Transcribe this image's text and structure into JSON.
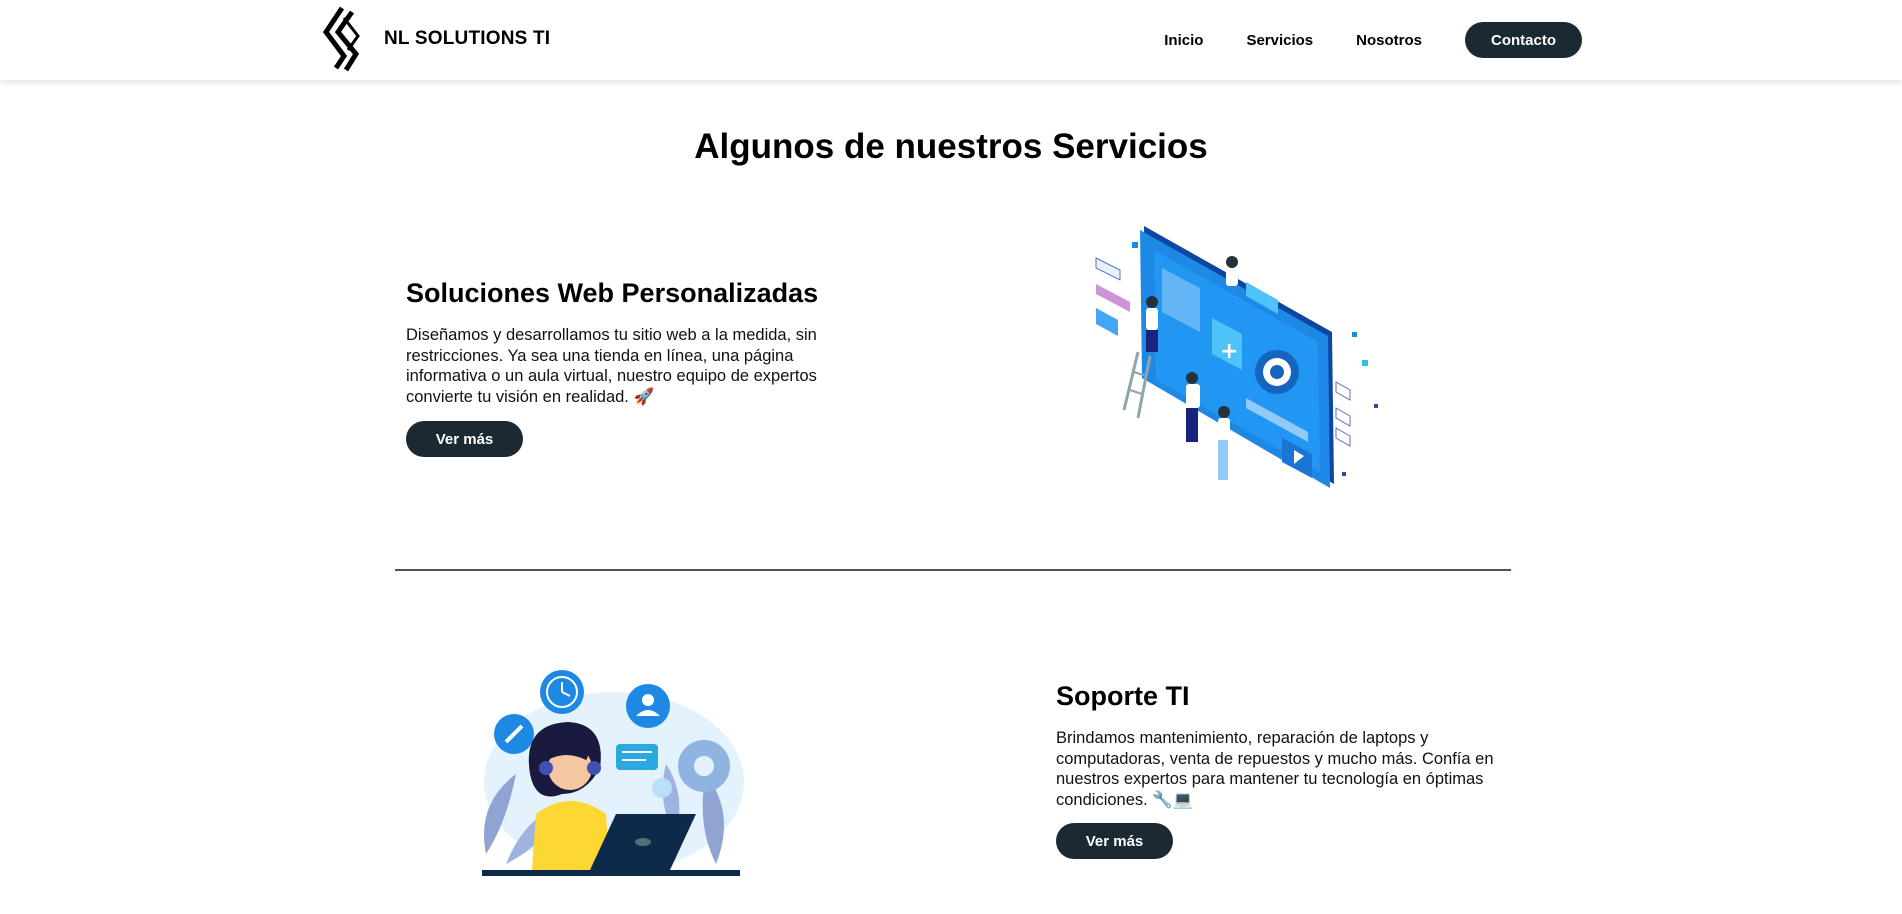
{
  "header": {
    "brand": "NL SOLUTIONS TI",
    "nav": [
      "Inicio",
      "Servicios",
      "Nosotros"
    ],
    "contact_label": "Contacto"
  },
  "main": {
    "title": "Algunos de nuestros Servicios",
    "services": [
      {
        "title": "Soluciones Web Personalizadas",
        "description": "Diseñamos y desarrollamos tu sitio web a la medida, sin restricciones. Ya sea una tienda en línea, una página informativa o un aula virtual, nuestro equipo de expertos convierte tu visión en realidad. 🚀",
        "button_label": "Ver más",
        "illustration": "web-development-illustration"
      },
      {
        "title": "Soporte TI",
        "description": "Brindamos mantenimiento, reparación de laptops y computadoras, venta de repuestos y mucho más. Confía en nuestros expertos para mantener tu tecnología en óptimas condiciones. 🔧💻",
        "button_label": "Ver más",
        "illustration": "it-support-illustration"
      }
    ]
  },
  "colors": {
    "button_bg": "#1b2a32",
    "accent_blue": "#1e88e5",
    "divider": "#4a5358"
  }
}
